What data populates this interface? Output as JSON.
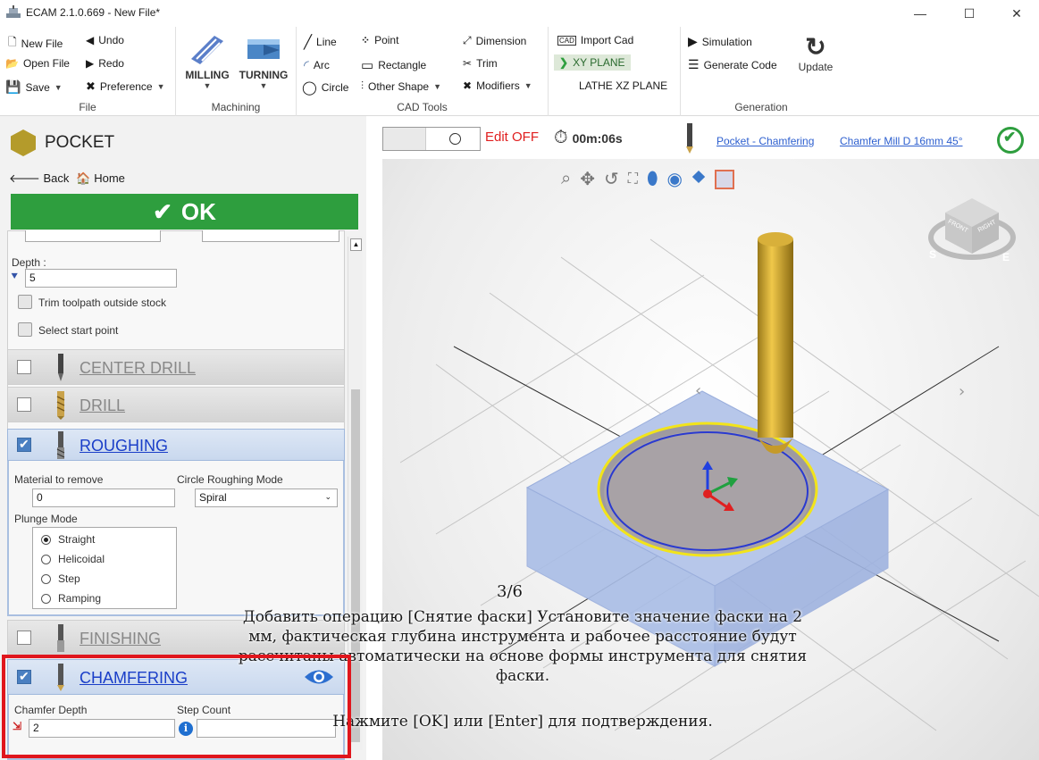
{
  "window": {
    "title": "ECAM 2.1.0.669 - New File*"
  },
  "ribbon": {
    "file": {
      "label": "File",
      "new_file": "New File",
      "undo": "Undo",
      "open_file": "Open File",
      "redo": "Redo",
      "save": "Save",
      "preference": "Preference"
    },
    "machining": {
      "label": "Machining",
      "milling": "MILLING",
      "turning": "TURNING"
    },
    "cad_tools": {
      "label": "CAD Tools",
      "line": "Line",
      "point": "Point",
      "dimension": "Dimension",
      "arc": "Arc",
      "rectangle": "Rectangle",
      "trim": "Trim",
      "circle": "Circle",
      "other_shape": "Other Shape",
      "modifiers": "Modifiers"
    },
    "import": {
      "import_cad": "Import Cad",
      "xy_plane": "XY PLANE",
      "lathe_xz_plane": "LATHE XZ PLANE"
    },
    "generation": {
      "label": "Generation",
      "simulation": "Simulation",
      "generate_code": "Generate Code",
      "update": "Update"
    }
  },
  "panel": {
    "title": "POCKET",
    "back": "Back",
    "home": "Home",
    "ok": "OK",
    "depth_label": "Depth :",
    "depth_value": "5",
    "trim_toolpath": "Trim toolpath outside stock",
    "select_start_point": "Select start point",
    "center_drill": "CENTER DRILL",
    "drill": "DRILL",
    "roughing": "ROUGHING",
    "material_to_remove": "Material to remove",
    "material_value": "0",
    "circle_roughing_mode": "Circle Roughing Mode",
    "circle_roughing_value": "Spiral",
    "plunge_mode": "Plunge Mode",
    "plunge_options": [
      "Straight",
      "Helicoidal",
      "Step",
      "Ramping"
    ],
    "finishing": "FINISHING",
    "chamfering": "CHAMFERING",
    "chamfer_depth": "Chamfer Depth",
    "chamfer_depth_value": "2",
    "step_count": "Step Count"
  },
  "viewbar": {
    "edit_state": "Edit OFF",
    "time": "00m:06s",
    "operation_link": "Pocket - Chamfering",
    "tool_link": "Chamfer Mill D 16mm 45°"
  },
  "viewcube": {
    "front": "FRONT",
    "right": "RIGHT",
    "compass": "S",
    "compass2": "E"
  },
  "tutorial": {
    "step": "3/6",
    "line1": "Добавить операцию [Снятие фаски] Установите значение фаски на 2",
    "line2": "мм, фактическая глубина инструмента и рабочее расстояние будут",
    "line3": "рассчитаны автоматически на основе формы инструмента для снятия",
    "line4": "фаски.",
    "line5": "Нажмите [OK] или [Enter] для подтверждения."
  },
  "colors": {
    "ok_green": "#2e9e3e",
    "edit_off_red": "#e01e1e",
    "link_blue": "#2d5fcf",
    "highlight_red": "#e0161d",
    "tool_gold": "#d4a52a",
    "stock_blue": "#a9bde6"
  }
}
